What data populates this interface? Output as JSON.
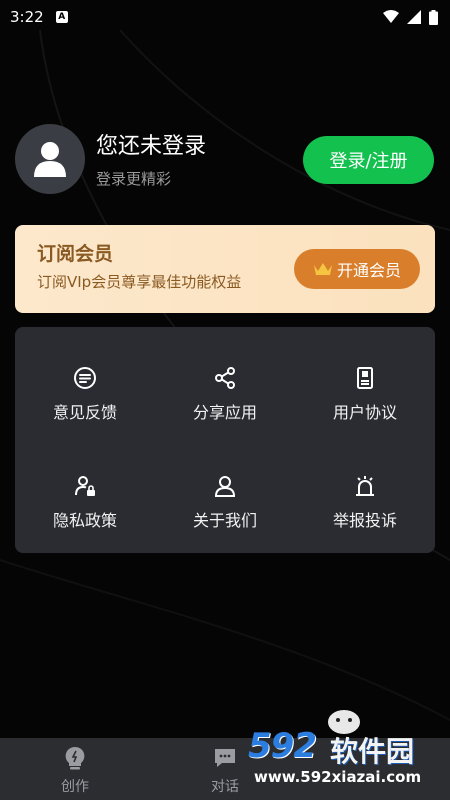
{
  "status_bar": {
    "time": "3:22",
    "notification_icon": "A"
  },
  "profile": {
    "title": "您还未登录",
    "subtitle": "登录更精彩",
    "login_button": "登录/注册"
  },
  "vip": {
    "title": "订阅会员",
    "subtitle": "订阅VIp会员尊享最佳功能权益",
    "button": "开通会员"
  },
  "menu": [
    {
      "label": "意见反馈",
      "icon": "feedback-icon"
    },
    {
      "label": "分享应用",
      "icon": "share-icon"
    },
    {
      "label": "用户协议",
      "icon": "agreement-icon"
    },
    {
      "label": "隐私政策",
      "icon": "privacy-icon"
    },
    {
      "label": "关于我们",
      "icon": "about-icon"
    },
    {
      "label": "举报投诉",
      "icon": "report-icon"
    }
  ],
  "bottom_nav": [
    {
      "label": "创作",
      "icon": "create-icon"
    },
    {
      "label": "对话",
      "icon": "chat-icon"
    }
  ],
  "watermark": {
    "brand_number": "592",
    "brand_name": "软件园",
    "url": "www.592xiazai.com"
  },
  "colors": {
    "accent_green": "#12c14e",
    "vip_orange": "#d97f2c",
    "card_bg": "#2a2c31"
  }
}
